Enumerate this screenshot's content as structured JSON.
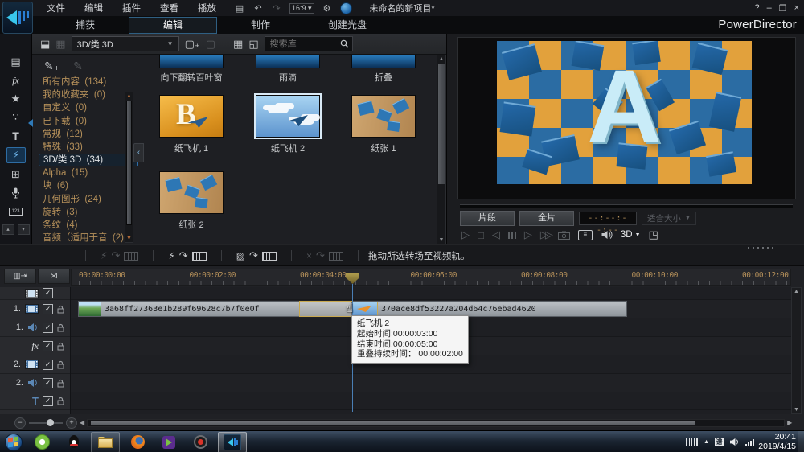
{
  "window": {
    "title": "未命名的新项目*",
    "brand": "PowerDirector",
    "controls": {
      "help": "?",
      "minimize": "–",
      "restore": "❐",
      "close": "×"
    },
    "aspect_ratio": "16:9"
  },
  "menu": {
    "items": [
      "文件",
      "编辑",
      "插件",
      "查看",
      "播放"
    ]
  },
  "tabs": [
    {
      "label": "捕获",
      "active": false
    },
    {
      "label": "编辑",
      "active": true
    },
    {
      "label": "制作",
      "active": false
    },
    {
      "label": "创建光盘",
      "active": false
    }
  ],
  "rail": [
    {
      "name": "media-room"
    },
    {
      "name": "effect-room"
    },
    {
      "name": "pip-objects-room"
    },
    {
      "name": "particle-room"
    },
    {
      "name": "title-room"
    },
    {
      "name": "transition-room",
      "selected": true
    },
    {
      "name": "audio-mixing-room"
    },
    {
      "name": "voice-over-room"
    },
    {
      "name": "chapter-room"
    }
  ],
  "library": {
    "category_dropdown": "3D/类 3D",
    "search_placeholder": "搜索库",
    "categories": [
      {
        "label": "所有内容",
        "count": "(134)",
        "selected": false
      },
      {
        "label": "我的收藏夹",
        "count": "(0)",
        "selected": false
      },
      {
        "label": "自定义",
        "count": "(0)",
        "selected": false
      },
      {
        "label": "已下载",
        "count": "(0)",
        "selected": false
      },
      {
        "label": "常规",
        "count": "(12)",
        "selected": false
      },
      {
        "label": "特殊",
        "count": "(33)",
        "selected": false
      },
      {
        "label": "3D/类 3D",
        "count": "(34)",
        "selected": true
      },
      {
        "label": "Alpha",
        "count": "(15)",
        "selected": false
      },
      {
        "label": "块",
        "count": "(6)",
        "selected": false
      },
      {
        "label": "几何图形",
        "count": "(24)",
        "selected": false
      },
      {
        "label": "旋转",
        "count": "(3)",
        "selected": false
      },
      {
        "label": "条纹",
        "count": "(4)",
        "selected": false
      },
      {
        "label": "音频（适用于音",
        "count": "(2)",
        "selected": false
      }
    ],
    "items": [
      {
        "label": "向下翻转百叶窗",
        "variant": "blue",
        "row": 0,
        "col": 0,
        "selected": false
      },
      {
        "label": "雨滴",
        "variant": "blue",
        "row": 0,
        "col": 1,
        "selected": false
      },
      {
        "label": "折叠",
        "variant": "blue",
        "row": 0,
        "col": 2,
        "selected": false
      },
      {
        "label": "纸飞机 1",
        "variant": "orange",
        "row": 1,
        "col": 0,
        "selected": false
      },
      {
        "label": "纸飞机 2",
        "variant": "sky",
        "row": 1,
        "col": 1,
        "selected": true
      },
      {
        "label": "纸张 1",
        "variant": "wood",
        "row": 1,
        "col": 2,
        "selected": false
      },
      {
        "label": "纸张 2",
        "variant": "wood",
        "row": 2,
        "col": 0,
        "selected": false
      }
    ]
  },
  "transition_bar": {
    "groups": [
      {
        "name": "apply-fading-to-all",
        "dim": true,
        "glyph": "⚡"
      },
      {
        "name": "apply-random-to-all",
        "dim": false,
        "glyph": "⚡"
      },
      {
        "name": "apply-selected-to-all",
        "dim": false,
        "glyph": "▨"
      },
      {
        "name": "remove-all-transitions",
        "dim": true,
        "glyph": "×"
      }
    ],
    "hint": "拖动所选转场至视频轨。"
  },
  "preview": {
    "clip_button": "片段",
    "movie_button": "全片",
    "timecode": "--:--:--:--",
    "fit_dropdown": "适合大小",
    "mode_3d": "3D",
    "frame_letter": "A"
  },
  "timeline": {
    "ruler_labels": [
      "00:00:00:00",
      "00:00:02:00",
      "00:00:04:00",
      "00:00:06:00",
      "00:00:08:00",
      "00:00:10:00",
      "00:00:12:00"
    ],
    "tracks": [
      {
        "num": "",
        "icon": "film-all",
        "lock": false
      },
      {
        "num": "1.",
        "icon": "video",
        "lock": true
      },
      {
        "num": "1.",
        "icon": "audio",
        "lock": true
      },
      {
        "num": "",
        "icon": "fx",
        "lock": true
      },
      {
        "num": "2.",
        "icon": "video",
        "lock": true
      },
      {
        "num": "2.",
        "icon": "audio",
        "lock": true
      },
      {
        "num": "",
        "icon": "title",
        "lock": true
      }
    ],
    "clips": [
      {
        "id": "3a68ff27363e1b289f69628c7b7f0e0f"
      },
      {
        "id": "370ace8df53227a204d64c76ebad4620"
      }
    ],
    "tooltip": {
      "name": "纸飞机 2",
      "start_line": "起始时间:00:00:03:00",
      "end_line": "结束时间:00:00:05:00",
      "overlap_line": "重叠持续时间： 00:00:02:00"
    }
  },
  "taskbar": {
    "icons": [
      {
        "name": "start-button"
      },
      {
        "name": "browser-360"
      },
      {
        "name": "qq"
      },
      {
        "name": "file-explorer",
        "open": true
      },
      {
        "name": "firefox"
      },
      {
        "name": "screen-recorder-play"
      },
      {
        "name": "recorder"
      },
      {
        "name": "powerdirector",
        "active": true
      }
    ],
    "clock_time": "20:41",
    "clock_date": "2019/4/15"
  },
  "colors": {
    "accent_blue": "#2f6da8",
    "category_gold": "#b5905a",
    "clip_gray": "#a9aeb4",
    "checker_orange": "#e2a13c",
    "checker_blue": "#2b6ca3"
  }
}
